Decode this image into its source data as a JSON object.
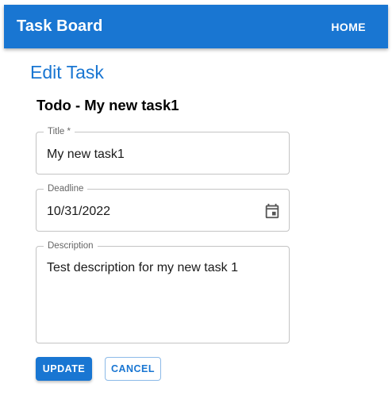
{
  "appbar": {
    "title": "Task Board",
    "home_label": "HOME"
  },
  "page": {
    "heading": "Edit Task",
    "task_heading": "Todo - My new task1"
  },
  "form": {
    "title": {
      "label": "Title *",
      "value": "My new task1"
    },
    "deadline": {
      "label": "Deadline",
      "value": "10/31/2022",
      "icon": "calendar-icon"
    },
    "description": {
      "label": "Description",
      "value": "Test description for my new task 1"
    }
  },
  "actions": {
    "update_label": "UPDATE",
    "cancel_label": "CANCEL"
  },
  "colors": {
    "primary": "#1976d2",
    "border": "#c4c4c4"
  }
}
